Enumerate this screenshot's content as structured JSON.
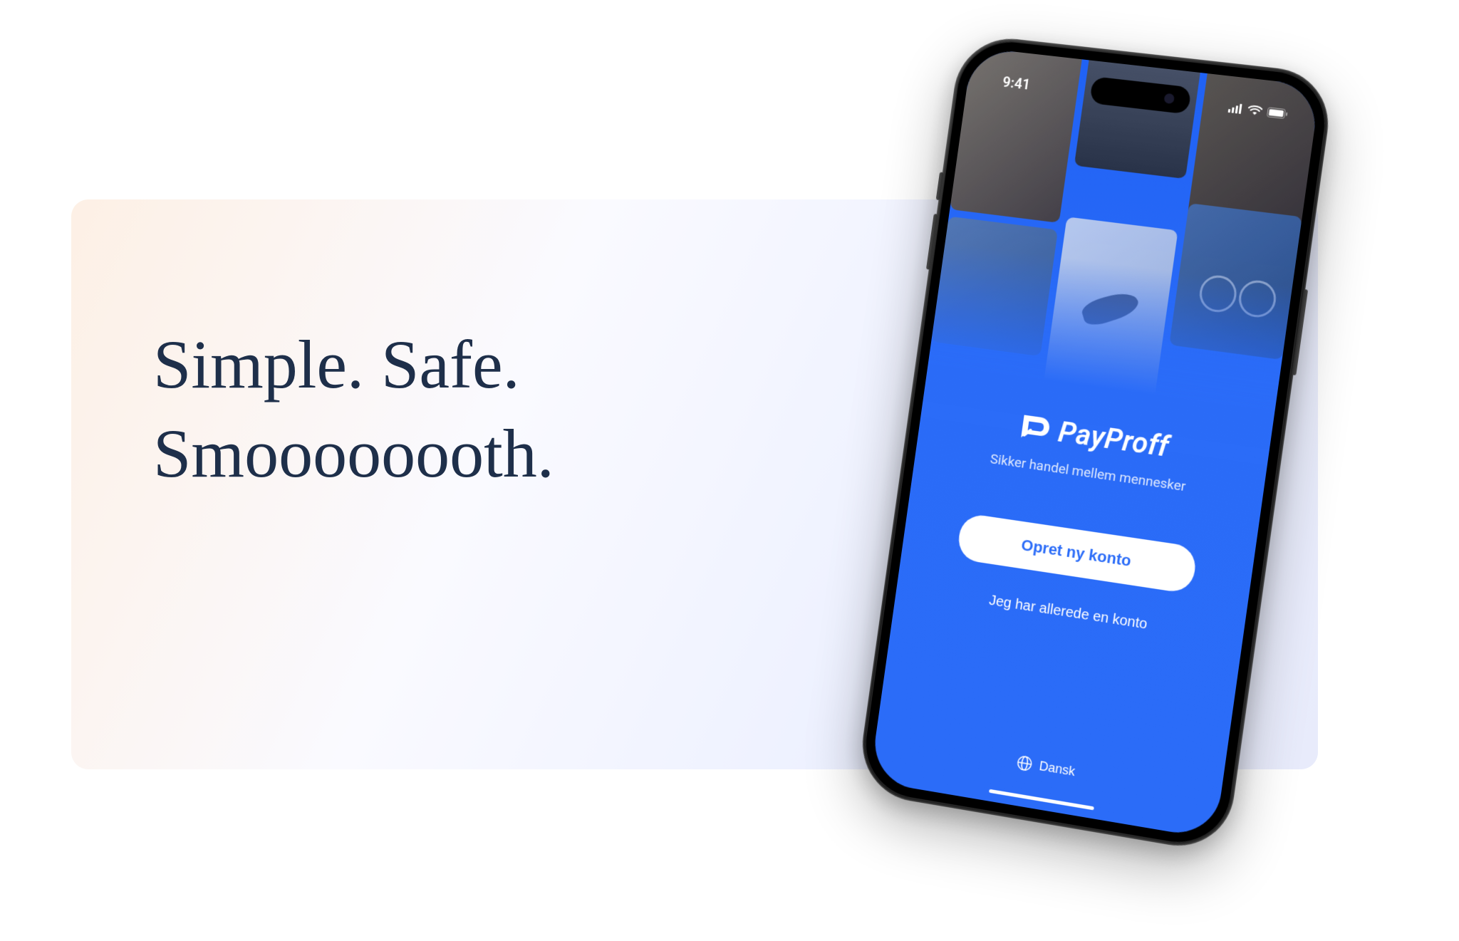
{
  "hero": {
    "headline": "Simple. Safe. Smoooooooth."
  },
  "phone": {
    "status_time": "9:41",
    "app_logo_name": "PayProff",
    "app_tagline": "Sikker handel mellem mennesker",
    "primary_button": "Opret ny konto",
    "secondary_link": "Jeg har allerede en konto",
    "language_label": "Dansk"
  }
}
